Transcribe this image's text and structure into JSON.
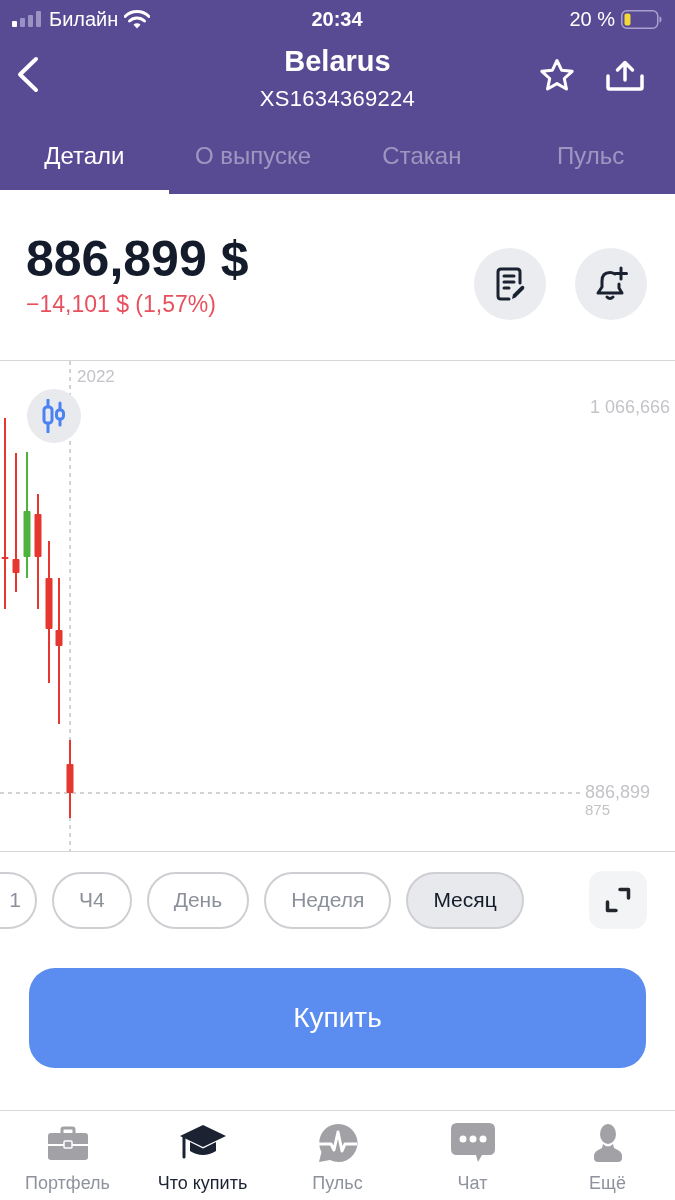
{
  "status_bar": {
    "carrier": "Билайн",
    "time": "20:34",
    "battery": "20 %"
  },
  "header": {
    "title": "Belarus",
    "subtitle": "XS1634369224"
  },
  "tabs": [
    {
      "label": "Детали",
      "selected": true
    },
    {
      "label": "О выпуске",
      "selected": false
    },
    {
      "label": "Стакан",
      "selected": false
    },
    {
      "label": "Пульс",
      "selected": false
    }
  ],
  "quote": {
    "price": "886,899 $",
    "change": "−14,101 $ (1,57%)"
  },
  "chart": {
    "year_label": "2022",
    "top_price": "1 066,666",
    "current_price": "886,899",
    "bottom_price": "875"
  },
  "periods": [
    {
      "label": "1",
      "selected": false
    },
    {
      "label": "Ч4",
      "selected": false
    },
    {
      "label": "День",
      "selected": false
    },
    {
      "label": "Неделя",
      "selected": false
    },
    {
      "label": "Месяц",
      "selected": true
    }
  ],
  "buy_button": {
    "label": "Купить"
  },
  "bottom_nav": [
    {
      "label": "Портфель",
      "selected": false
    },
    {
      "label": "Что купить",
      "selected": true
    },
    {
      "label": "Пульс",
      "selected": false
    },
    {
      "label": "Чат",
      "selected": false
    },
    {
      "label": "Ещё",
      "selected": false
    }
  ]
}
